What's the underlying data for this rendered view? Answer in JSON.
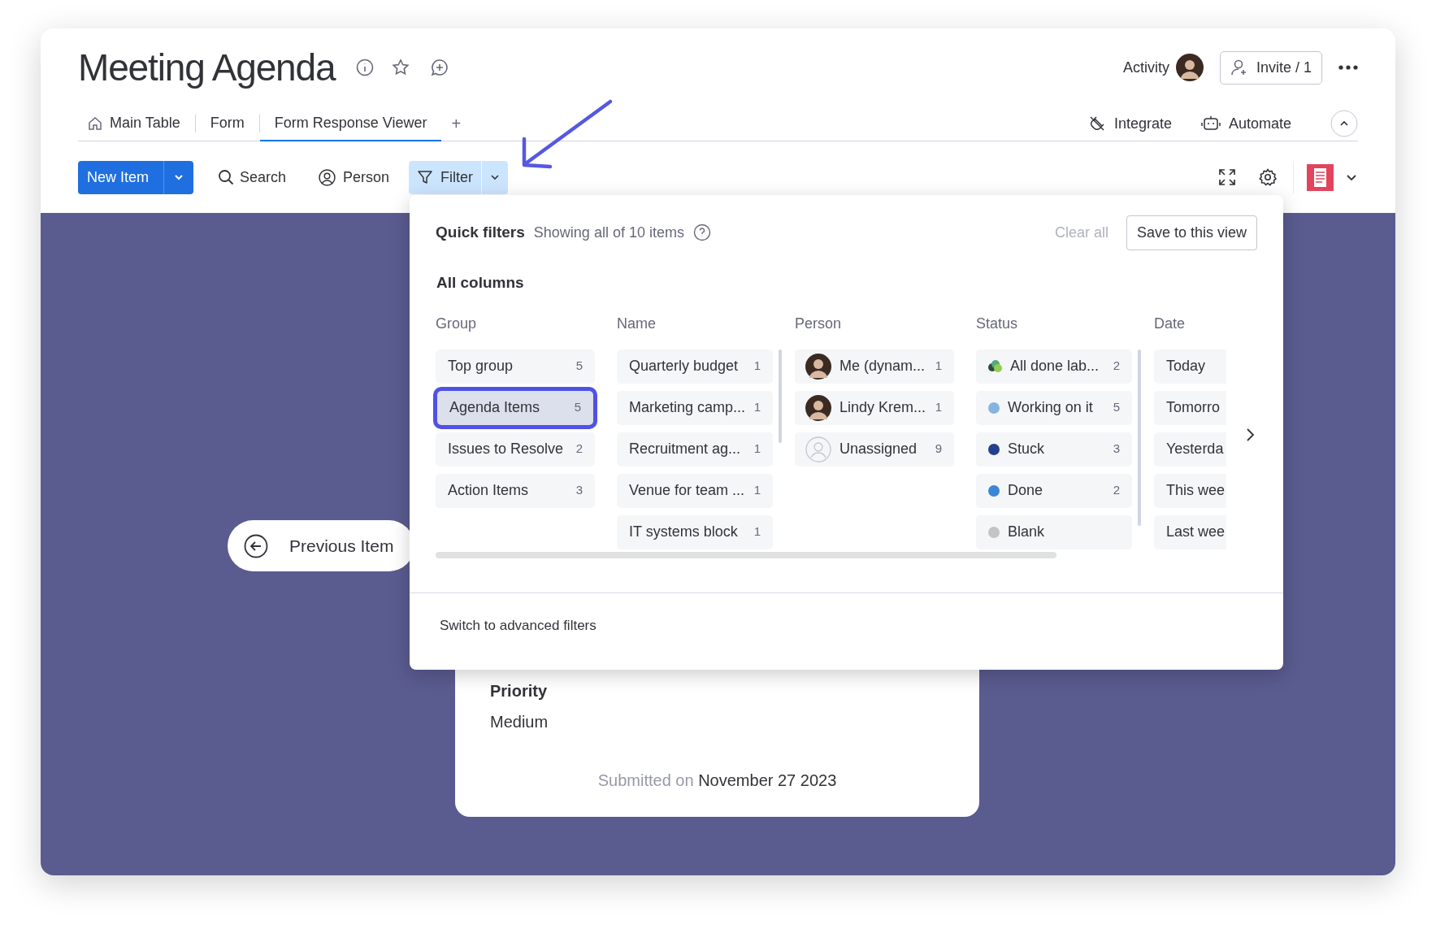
{
  "header": {
    "title": "Meeting Agenda",
    "activity": "Activity",
    "invite": "Invite / 1"
  },
  "tabs": [
    {
      "label": "Main Table",
      "selected": false,
      "kind": "home"
    },
    {
      "label": "Form",
      "selected": false,
      "kind": "plain"
    },
    {
      "label": "Form Response Viewer",
      "selected": true,
      "kind": "plain"
    }
  ],
  "add_tab": "+",
  "board_actions": [
    {
      "label": "Integrate",
      "kind": "integrate"
    },
    {
      "label": "Automate",
      "kind": "automate"
    }
  ],
  "toolbar": {
    "new_item": "New Item",
    "search": "Search",
    "person": "Person",
    "filter": "Filter",
    "filter_active": true
  },
  "filter_panel": {
    "title": "Quick filters",
    "summary": "Showing all of 10 items",
    "clear_all": "Clear all",
    "save": "Save to this view",
    "section": "All columns",
    "columns": [
      {
        "heading": "Group",
        "items": [
          {
            "label": "Top group",
            "count": "5",
            "selected": false,
            "kind": "plain"
          },
          {
            "label": "Agenda Items",
            "count": "5",
            "selected": true,
            "kind": "plain"
          },
          {
            "label": "Issues to Resolve",
            "count": "2",
            "selected": false,
            "kind": "plain"
          },
          {
            "label": "Action Items",
            "count": "3",
            "selected": false,
            "kind": "plain"
          }
        ]
      },
      {
        "heading": "Name",
        "items": [
          {
            "label": "Quarterly budget",
            "count": "1",
            "selected": false,
            "kind": "plain"
          },
          {
            "label": "Marketing camp...",
            "count": "1",
            "selected": false,
            "kind": "plain"
          },
          {
            "label": "Recruitment ag...",
            "count": "1",
            "selected": false,
            "kind": "plain"
          },
          {
            "label": "Venue for team ...",
            "count": "1",
            "selected": false,
            "kind": "plain"
          },
          {
            "label": "IT systems block",
            "count": "1",
            "selected": false,
            "kind": "plain"
          }
        ]
      },
      {
        "heading": "Person",
        "items": [
          {
            "label": "Me (dynam...",
            "count": "1",
            "selected": false,
            "kind": "avatar"
          },
          {
            "label": "Lindy Krem...",
            "count": "1",
            "selected": false,
            "kind": "avatar"
          },
          {
            "label": "Unassigned",
            "count": "9",
            "selected": false,
            "kind": "unassigned"
          }
        ]
      },
      {
        "heading": "Status",
        "items": [
          {
            "label": "All done lab...",
            "count": "2",
            "selected": false,
            "kind": "multi"
          },
          {
            "label": "Working on it",
            "count": "5",
            "selected": false,
            "kind": "dot",
            "color": "#86b4e0"
          },
          {
            "label": "Stuck",
            "count": "3",
            "selected": false,
            "kind": "dot",
            "color": "#24408e"
          },
          {
            "label": "Done",
            "count": "2",
            "selected": false,
            "kind": "dot",
            "color": "#3b86d6"
          },
          {
            "label": "Blank",
            "selected": false,
            "kind": "dot",
            "color": "#c4c4c4"
          }
        ]
      },
      {
        "heading": "Date",
        "items": [
          {
            "label": "Today",
            "selected": false,
            "kind": "plain"
          },
          {
            "label": "Tomorro",
            "selected": false,
            "kind": "plain"
          },
          {
            "label": "Yesterda",
            "selected": false,
            "kind": "plain"
          },
          {
            "label": "This wee",
            "selected": false,
            "kind": "plain"
          },
          {
            "label": "Last wee",
            "selected": false,
            "kind": "plain"
          }
        ]
      }
    ],
    "footer": "Switch to advanced filters"
  },
  "previous_item": "Previous Item",
  "form_card": {
    "field_label": "Priority",
    "field_value": "Medium",
    "submitted_label": "Submitted on",
    "submitted_date": "November 27 2023"
  }
}
